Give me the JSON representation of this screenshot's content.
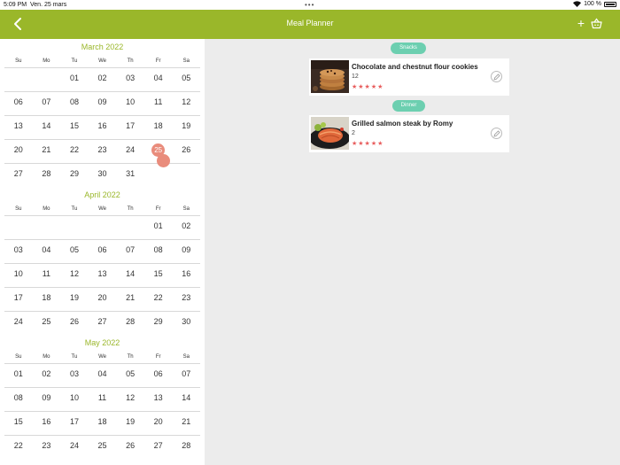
{
  "status_bar": {
    "time": "5:09 PM",
    "date": "Ven. 25 mars",
    "battery": "100 %"
  },
  "nav": {
    "title": "Meal Planner",
    "accent_color": "#9ab72a"
  },
  "calendar": {
    "weekdays": [
      "Su",
      "Mo",
      "Tu",
      "We",
      "Th",
      "Fr",
      "Sa"
    ],
    "months": [
      {
        "title": "March 2022",
        "weeks": [
          [
            "",
            "",
            "01",
            "02",
            "03",
            "04",
            "05"
          ],
          [
            "06",
            "07",
            "08",
            "09",
            "10",
            "11",
            "12"
          ],
          [
            "13",
            "14",
            "15",
            "16",
            "17",
            "18",
            "19"
          ],
          [
            "20",
            "21",
            "22",
            "23",
            "24",
            "25",
            "26"
          ],
          [
            "27",
            "28",
            "29",
            "30",
            "31",
            "",
            ""
          ]
        ]
      },
      {
        "title": "April 2022",
        "weeks": [
          [
            "",
            "",
            "",
            "",
            "",
            "01",
            "02"
          ],
          [
            "03",
            "04",
            "05",
            "06",
            "07",
            "08",
            "09"
          ],
          [
            "10",
            "11",
            "12",
            "13",
            "14",
            "15",
            "16"
          ],
          [
            "17",
            "18",
            "19",
            "20",
            "21",
            "22",
            "23"
          ],
          [
            "24",
            "25",
            "26",
            "27",
            "28",
            "29",
            "30"
          ]
        ]
      },
      {
        "title": "May 2022",
        "weeks": [
          [
            "01",
            "02",
            "03",
            "04",
            "05",
            "06",
            "07"
          ],
          [
            "08",
            "09",
            "10",
            "11",
            "12",
            "13",
            "14"
          ],
          [
            "15",
            "16",
            "17",
            "18",
            "19",
            "20",
            "21"
          ],
          [
            "22",
            "23",
            "24",
            "25",
            "26",
            "27",
            "28"
          ]
        ]
      }
    ],
    "today": "25",
    "today_color": "#e98c7c"
  },
  "meals": [
    {
      "category": "Snacks",
      "name": "Chocolate and chestnut flour cookies",
      "quantity": "12",
      "stars": "★★★★★",
      "photo_icon": "cookies-photo"
    },
    {
      "category": "Dinner",
      "name": "Grilled salmon steak by Romy",
      "quantity": "2",
      "stars": "★★★★★",
      "photo_icon": "salmon-photo"
    }
  ],
  "tag_color": "#6ccfb0",
  "star_color": "#e85d5d"
}
